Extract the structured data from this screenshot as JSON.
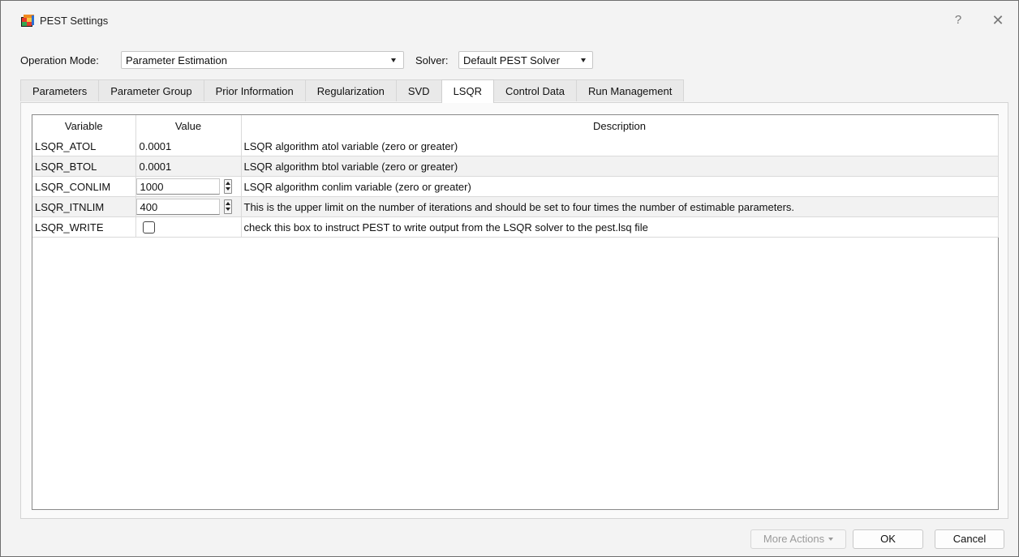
{
  "window": {
    "title": "PEST Settings",
    "help_glyph": "?",
    "close_glyph": "✕"
  },
  "toolbar": {
    "operation_mode_label": "Operation Mode:",
    "operation_mode_value": "Parameter Estimation",
    "solver_label": "Solver:",
    "solver_value": "Default PEST Solver"
  },
  "tabs": [
    {
      "label": "Parameters",
      "active": false
    },
    {
      "label": "Parameter Group",
      "active": false
    },
    {
      "label": "Prior Information",
      "active": false
    },
    {
      "label": "Regularization",
      "active": false
    },
    {
      "label": "SVD",
      "active": false
    },
    {
      "label": "LSQR",
      "active": true
    },
    {
      "label": "Control Data",
      "active": false
    },
    {
      "label": "Run Management",
      "active": false
    }
  ],
  "table": {
    "headers": {
      "variable": "Variable",
      "value": "Value",
      "description": "Description"
    },
    "rows": [
      {
        "variable": "LSQR_ATOL",
        "value": "0.0001",
        "description": "LSQR algorithm atol variable (zero or greater)",
        "editor": "text"
      },
      {
        "variable": "LSQR_BTOL",
        "value": "0.0001",
        "description": "LSQR algorithm btol variable (zero or greater)",
        "editor": "text"
      },
      {
        "variable": "LSQR_CONLIM",
        "value": "1000",
        "description": "LSQR algorithm conlim variable (zero or greater)",
        "editor": "spinbox"
      },
      {
        "variable": "LSQR_ITNLIM",
        "value": "400",
        "description": "This is the upper limit on the number of iterations and should be set to four times the number of estimable parameters.",
        "editor": "spinbox"
      },
      {
        "variable": "LSQR_WRITE",
        "value": false,
        "description": "check this box to instruct PEST to write output from the LSQR solver to the pest.lsq file",
        "editor": "checkbox"
      }
    ]
  },
  "footer": {
    "more_actions_label": "More Actions",
    "ok_label": "OK",
    "cancel_label": "Cancel"
  },
  "colors": {
    "window_bg": "#f3f3f3",
    "alt_row": "#f2f2f2",
    "disabled_text": "#9a9a9a"
  }
}
